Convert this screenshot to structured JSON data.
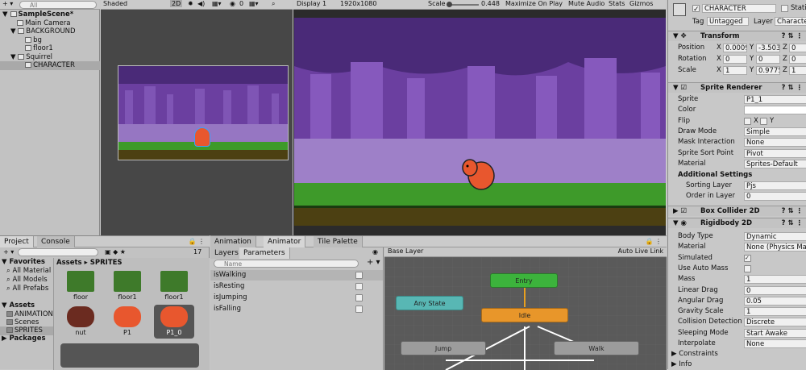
{
  "hierarchy": {
    "search_placeholder": "All",
    "items": [
      {
        "label": "SampleScene*",
        "indent": 0,
        "arrow": "▼"
      },
      {
        "label": "Main Camera",
        "indent": 1,
        "arrow": ""
      },
      {
        "label": "BACKGROUND",
        "indent": 1,
        "arrow": "▼"
      },
      {
        "label": "bg",
        "indent": 2,
        "arrow": ""
      },
      {
        "label": "floor1",
        "indent": 2,
        "arrow": ""
      },
      {
        "label": "Squirrel",
        "indent": 1,
        "arrow": "▼"
      },
      {
        "label": "CHARACTER",
        "indent": 2,
        "arrow": "",
        "selected": true
      }
    ]
  },
  "scene": {
    "shading": "Shaded",
    "mode2d": "2D",
    "gizmo_count": "0"
  },
  "game": {
    "display": "Display 1",
    "resolution": "1920x1080",
    "scale_label": "Scale",
    "scale_value": "0.448",
    "max_on_play": "Maximize On Play",
    "mute": "Mute Audio",
    "stats": "Stats",
    "gizmos": "Gizmos"
  },
  "inspector": {
    "name": "CHARACTER",
    "static": "Static",
    "tag_label": "Tag",
    "tag": "Untagged",
    "layer_label": "Layer",
    "layer": "Characte",
    "transform": {
      "title": "Transform",
      "rows": [
        {
          "label": "Position",
          "x": "0.0009",
          "y": "-3.503",
          "z": "0"
        },
        {
          "label": "Rotation",
          "x": "0",
          "y": "0",
          "z": "0"
        },
        {
          "label": "Scale",
          "x": "1",
          "y": "0.9775",
          "z": "1"
        }
      ]
    },
    "sprite_renderer": {
      "title": "Sprite Renderer",
      "sprite_label": "Sprite",
      "sprite": "P1_1",
      "color_label": "Color",
      "flip_label": "Flip",
      "flip_x": "X",
      "flip_y": "Y",
      "draw_mode_label": "Draw Mode",
      "draw_mode": "Simple",
      "mask_label": "Mask Interaction",
      "mask": "None",
      "sort_point_label": "Sprite Sort Point",
      "sort_point": "Pivot",
      "material_label": "Material",
      "material": "Sprites-Default",
      "additional": "Additional Settings",
      "sorting_layer_label": "Sorting Layer",
      "sorting_layer": "Pjs",
      "order_label": "Order in Layer",
      "order": "0"
    },
    "box_collider": {
      "title": "Box Collider 2D"
    },
    "rigidbody": {
      "title": "Rigidbody 2D",
      "body_type_label": "Body Type",
      "body_type": "Dynamic",
      "material_label": "Material",
      "material": "None (Physics Ma",
      "simulated_label": "Simulated",
      "auto_mass_label": "Use Auto Mass",
      "mass_label": "Mass",
      "mass": "1",
      "linear_drag_label": "Linear Drag",
      "linear_drag": "0",
      "angular_drag_label": "Angular Drag",
      "angular_drag": "0.05",
      "gravity_label": "Gravity Scale",
      "gravity": "1",
      "collision_label": "Collision Detection",
      "collision": "Discrete",
      "sleeping_label": "Sleeping Mode",
      "sleeping": "Start Awake",
      "interpolate_label": "Interpolate",
      "interpolate": "None",
      "constraints": "Constraints",
      "info": "Info"
    }
  },
  "project": {
    "tabs": [
      "Project",
      "Console"
    ],
    "count": "17",
    "favorites": "Favorites",
    "fav_items": [
      "All Material",
      "All Models",
      "All Prefabs"
    ],
    "assets": "Assets",
    "asset_items": [
      "ANIMATION",
      "Scenes",
      "SPRITES"
    ],
    "packages": "Packages",
    "breadcrumb": "Assets ▸ SPRITES",
    "thumbs": [
      "floor",
      "floor1",
      "floor1",
      "nut",
      "P1",
      "P1_0"
    ]
  },
  "animator": {
    "tabs": [
      "Animation",
      "Animator",
      "Tile Palette"
    ],
    "subtabs": [
      "Layers",
      "Parameters"
    ],
    "search_placeholder": "Name",
    "params": [
      "isWalking",
      "isResting",
      "isJumping",
      "isFalling"
    ],
    "base_layer": "Base Layer",
    "auto_live": "Auto Live Link",
    "states": {
      "entry": "Entry",
      "any": "Any State",
      "idle": "Idle",
      "jump": "Jump",
      "walk": "Walk"
    }
  }
}
